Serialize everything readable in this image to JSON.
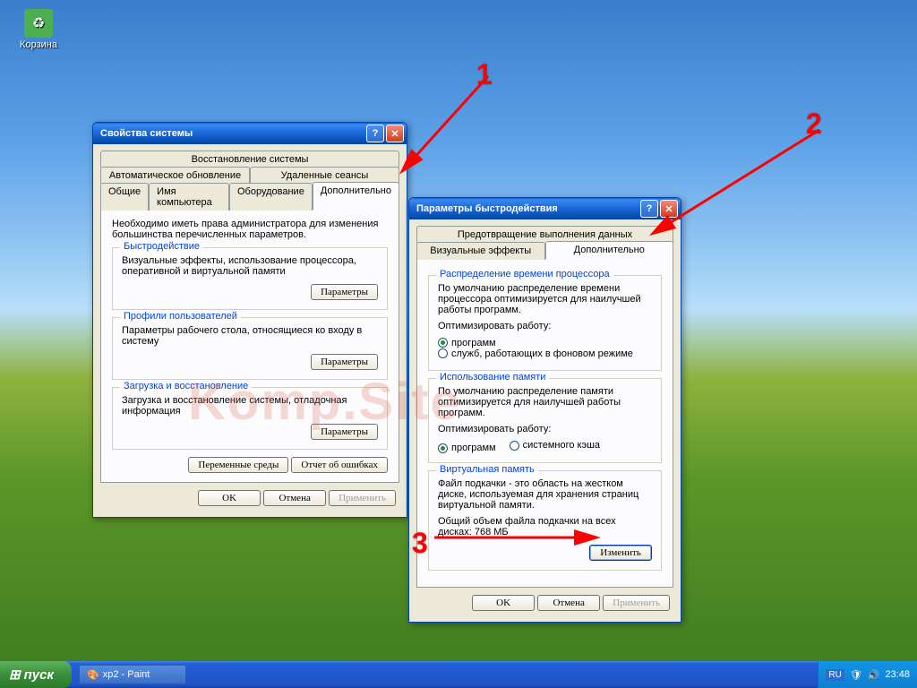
{
  "desktop": {
    "recycle_bin": "Корзина"
  },
  "window1": {
    "title": "Свойства системы",
    "tab_row1": [
      "Восстановление системы"
    ],
    "tab_row2": [
      "Автоматическое обновление",
      "Удаленные сеансы"
    ],
    "tab_row3": [
      "Общие",
      "Имя компьютера",
      "Оборудование",
      "Дополнительно"
    ],
    "intro": "Необходимо иметь права администратора для изменения большинства перечисленных параметров.",
    "group1": {
      "title": "Быстродействие",
      "text": "Визуальные эффекты, использование процессора, оперативной и виртуальной памяти",
      "btn": "Параметры"
    },
    "group2": {
      "title": "Профили пользователей",
      "text": "Параметры рабочего стола, относящиеся ко входу в систему",
      "btn": "Параметры"
    },
    "group3": {
      "title": "Загрузка и восстановление",
      "text": "Загрузка и восстановление системы, отладочная информация",
      "btn": "Параметры"
    },
    "btn_env": "Переменные среды",
    "btn_err": "Отчет об ошибках",
    "ok": "OK",
    "cancel": "Отмена",
    "apply": "Применить"
  },
  "window2": {
    "title": "Параметры быстродействия",
    "tab_row1": [
      "Предотвращение выполнения данных"
    ],
    "tab_row2": [
      "Визуальные эффекты",
      "Дополнительно"
    ],
    "group1": {
      "title": "Распределение времени процессора",
      "text": "По умолчанию распределение времени процессора оптимизируется для наилучшей работы программ.",
      "label": "Оптимизировать работу:",
      "opt1": "программ",
      "opt2": "служб, работающих в фоновом режиме"
    },
    "group2": {
      "title": "Использование памяти",
      "text": "По умолчанию распределение памяти оптимизируется для наилучшей работы программ.",
      "label": "Оптимизировать работу:",
      "opt1": "программ",
      "opt2": "системного кэша"
    },
    "group3": {
      "title": "Виртуальная память",
      "text1": "Файл подкачки - это область на жестком диске, используемая для хранения страниц виртуальной памяти.",
      "text2": "Общий объем файла подкачки на всех дисках:  768 МБ",
      "btn": "Изменить"
    },
    "ok": "OK",
    "cancel": "Отмена",
    "apply": "Применить"
  },
  "taskbar": {
    "start": "пуск",
    "task1": "xp2 - Paint",
    "lang": "RU",
    "time": "23:48"
  },
  "annotations": {
    "a1": "1",
    "a2": "2",
    "a3": "3"
  },
  "watermark": "Komp.Site"
}
